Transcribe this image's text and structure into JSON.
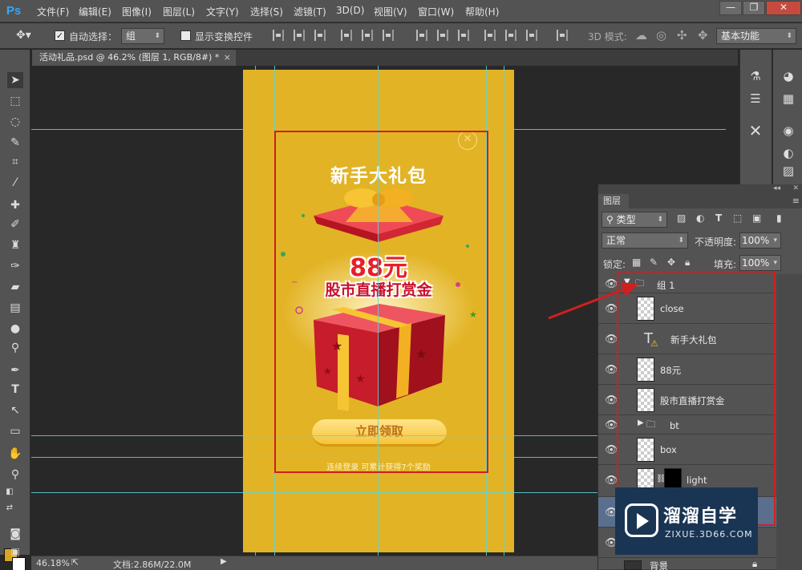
{
  "app": {
    "logo": "Ps"
  },
  "menu": [
    "文件(F)",
    "编辑(E)",
    "图像(I)",
    "图层(L)",
    "文字(Y)",
    "选择(S)",
    "滤镜(T)",
    "3D(D)",
    "视图(V)",
    "窗口(W)",
    "帮助(H)"
  ],
  "window_controls": {
    "minimize": "—",
    "restore": "❐",
    "close": "✕"
  },
  "options_bar": {
    "auto_select_label": "自动选择：",
    "auto_select_value": "组",
    "show_transform_label": "显示变换控件",
    "mode_3d_label": "3D 模式:",
    "workspace_value": "基本功能"
  },
  "document_tab": {
    "title": "活动礼品.psd @ 46.2% (图层 1, RGB/8#) *",
    "close": "×"
  },
  "canvas": {
    "close_icon": "✕",
    "title": "新手大礼包",
    "amount": "88元",
    "subtitle": "股市直播打赏金",
    "button_label": "立即领取",
    "hint": "连续登录 可累计获得7个奖励"
  },
  "status_bar": {
    "zoom": "46.18%",
    "doc_info": "文档:2.86M/22.0M"
  },
  "layers_panel": {
    "tab_label": "图层",
    "filter_label": "类型",
    "blend_mode": "正常",
    "opacity_label": "不透明度:",
    "opacity_value": "100%",
    "lock_label": "锁定:",
    "fill_label": "填充:",
    "fill_value": "100%",
    "layers": [
      {
        "name": "组 1",
        "kind": "group",
        "expanded": true
      },
      {
        "name": "close",
        "kind": "smart"
      },
      {
        "name": "新手大礼包",
        "kind": "text"
      },
      {
        "name": "88元",
        "kind": "smart"
      },
      {
        "name": "股市直播打赏金",
        "kind": "smart"
      },
      {
        "name": "bt",
        "kind": "group",
        "expanded": false
      },
      {
        "name": "box",
        "kind": "smart"
      },
      {
        "name": "light",
        "kind": "masked"
      },
      {
        "name": "背景",
        "kind": "background"
      }
    ]
  },
  "watermark": {
    "title": "溜溜自学",
    "url": "ZIXUE.3D66.COM"
  },
  "colors": {
    "artboard": "#e2b325",
    "guide": "#5fd6d6",
    "annotation_red": "#d11f1f",
    "ui_panel": "#535353",
    "canvas_bg": "#282828"
  }
}
